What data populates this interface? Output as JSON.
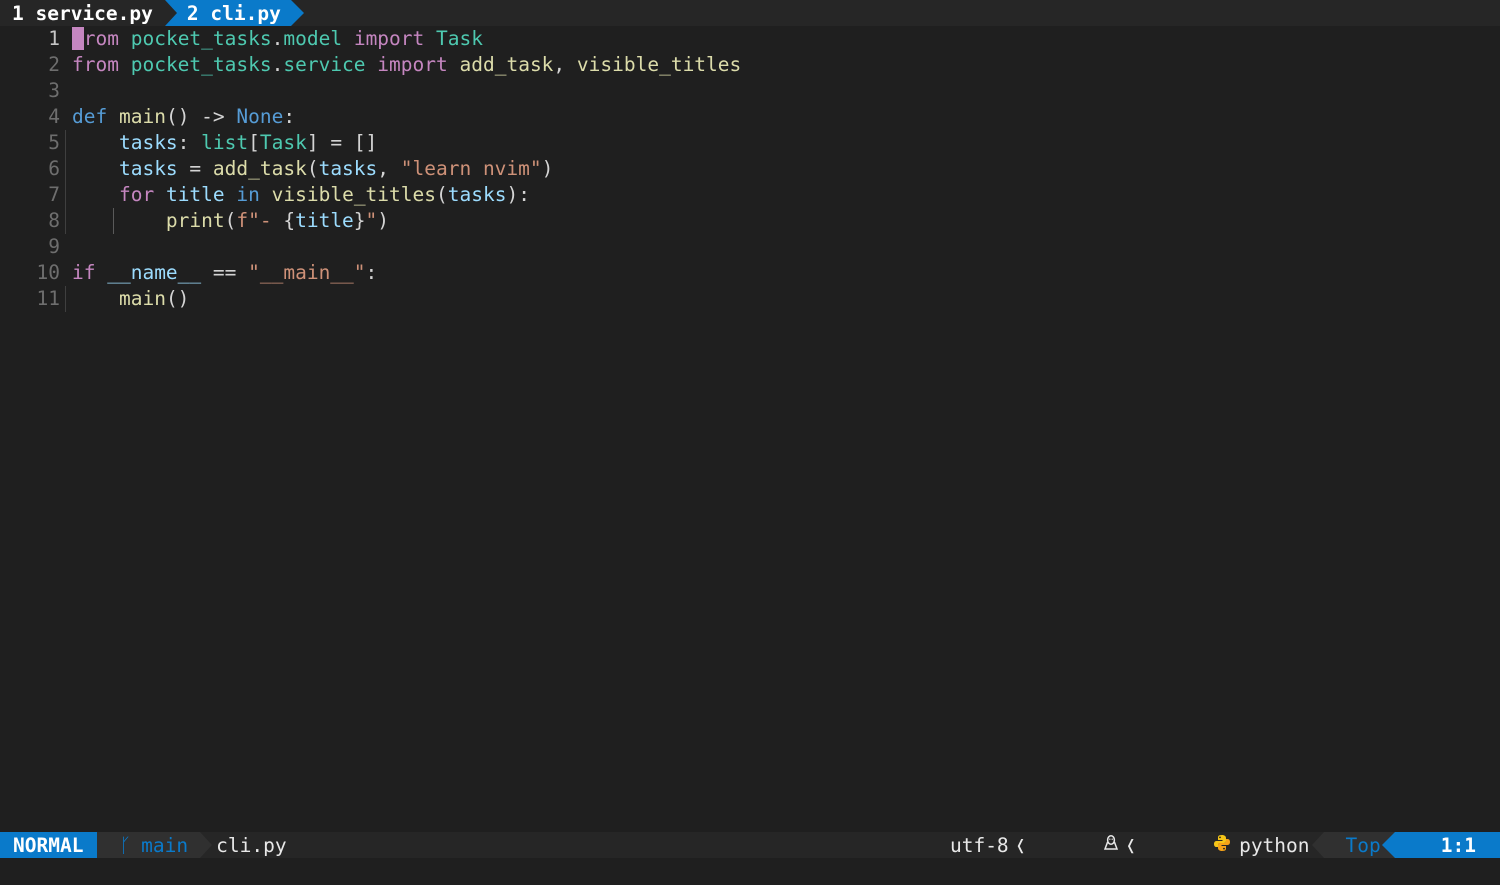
{
  "tabline": {
    "tabs": [
      {
        "label": "1 service.py",
        "active": false
      },
      {
        "label": "2 cli.py",
        "active": true
      }
    ]
  },
  "editor": {
    "line_numbers": [
      "1",
      "2",
      "3",
      "4",
      "5",
      "6",
      "7",
      "8",
      "9",
      "10",
      "11"
    ],
    "cursor_char": "f",
    "tokens": {
      "l1_rest": "rom",
      "from": "from",
      "import": "import",
      "mod1": "pocket_tasks",
      "mod1b": "model",
      "mod2b": "service",
      "dot": ".",
      "Task": "Task",
      "add_task": "add_task",
      "comma": ", ",
      "visible_titles": "visible_titles",
      "def": "def",
      "main": "main",
      "parens": "()",
      "arrow": " -> ",
      "None": "None",
      "colon": ":",
      "tasks": "tasks",
      "colon_sp": ": ",
      "list": "list",
      "lbr": "[",
      "rbr": "]",
      "eq_empty": " = []",
      "eq": " = ",
      "lparen": "(",
      "rparen": ")",
      "str_learn": "\"learn nvim\"",
      "for": "for",
      "title": "title",
      "in": "in",
      "rparen_colon": "):",
      "print": "print",
      "fstr_open": "f\"- ",
      "lbrace": "{",
      "rbrace": "}",
      "fstr_close": "\"",
      "if": "if",
      "dunder_name": "__name__",
      "eqeq": " == ",
      "str_main": "\"__main__\""
    }
  },
  "statusline": {
    "mode": "NORMAL",
    "branch_icon": "git-branch-icon",
    "branch_glyph": "ᚴ",
    "branch": "main",
    "filename": "cli.py",
    "encoding": "utf-8",
    "separator": "❬",
    "os_icon": "linux-tux-icon",
    "os_glyph": "🐧",
    "filetype_icon": "python-icon",
    "filetype": "python",
    "scroll_position": "Top",
    "cursor_position": "1:1"
  },
  "colors": {
    "accent": "#0a7aca",
    "background": "#1f1f1f",
    "keyword": "#c586c0",
    "builtin": "#569cd6",
    "type": "#4ec9b0",
    "function": "#dcdcaa",
    "variable": "#9cdcfe",
    "string": "#ce9178"
  }
}
